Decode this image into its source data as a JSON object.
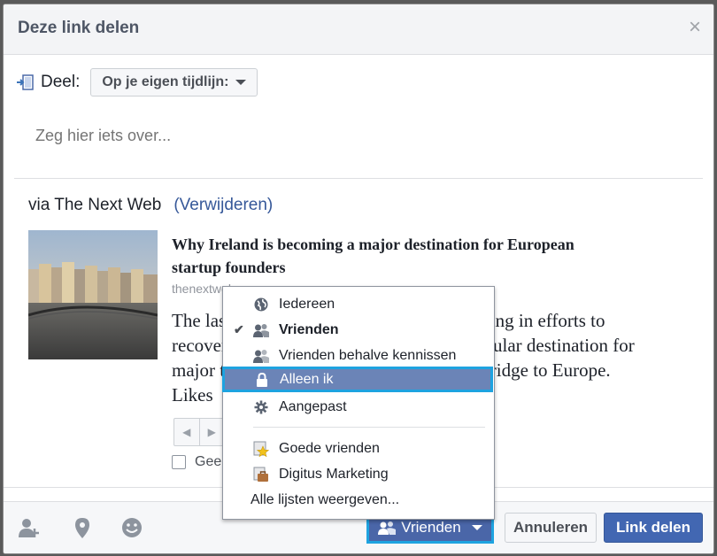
{
  "dialog": {
    "title": "Deze link delen",
    "close_glyph": "×"
  },
  "share_target": {
    "label": "Deel:",
    "selected": "Op je eigen tijdlijn:"
  },
  "message": {
    "placeholder": "Zeg hier iets over..."
  },
  "source": {
    "via": "via The Next Web",
    "remove": "(Verwijderen)"
  },
  "article": {
    "title": "Why Ireland is becoming a major destination for European startup founders",
    "domain": "thenextweb.com",
    "description_lines": [
      "The last few years Ireland has been struggling in efforts to",
      "recover from recession. Now it's also a popular destination for",
      "major tech firms and startups, acting as a bridge to Europe.",
      "Likes"
    ]
  },
  "thumbnail": {
    "no_thumbnail_label": "Geen miniatuurweergave"
  },
  "audience_menu": {
    "items": [
      {
        "label": "Iedereen",
        "icon": "globe-icon",
        "checked": false,
        "bold": false
      },
      {
        "label": "Vrienden",
        "icon": "friends-icon",
        "checked": true,
        "bold": true
      },
      {
        "label": "Vrienden behalve kennissen",
        "icon": "friends-except-icon",
        "checked": false,
        "bold": false
      },
      {
        "label": "Alleen ik",
        "icon": "lock-icon",
        "checked": false,
        "bold": false,
        "highlighted": true
      },
      {
        "label": "Aangepast",
        "icon": "gear-icon",
        "checked": false,
        "bold": false
      },
      {
        "label": "Goede vrienden",
        "icon": "star-list-icon",
        "checked": false,
        "bold": false
      },
      {
        "label": "Digitus Marketing",
        "icon": "briefcase-list-icon",
        "checked": false,
        "bold": false
      }
    ],
    "show_all": "Alle lijsten weergeven...",
    "check_glyph": "✔"
  },
  "footer": {
    "audience_button": "Vrienden",
    "cancel": "Annuleren",
    "share": "Link delen"
  },
  "colors": {
    "primary_blue": "#4267b2",
    "highlight_border": "#1ea3e0",
    "menu_selected": "#6b84b7"
  }
}
